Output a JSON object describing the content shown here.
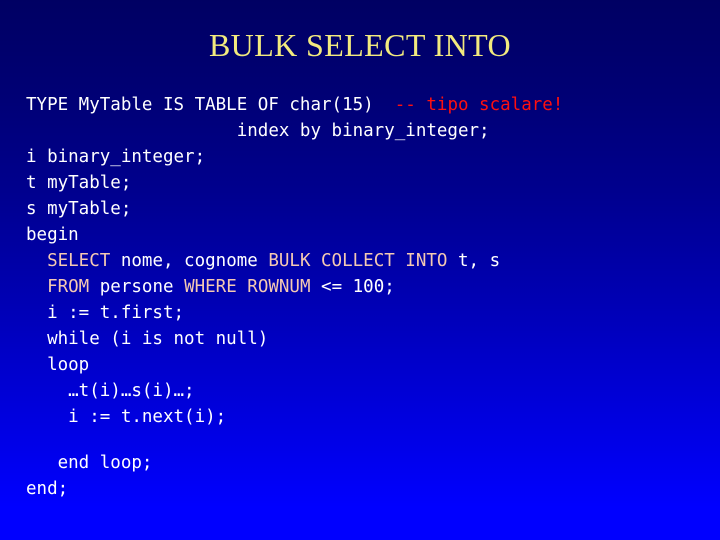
{
  "slide": {
    "title": "BULK SELECT INTO",
    "colors": {
      "background_top": "#000063",
      "background_bottom": "#0000ff",
      "title_text": "#f2ea7e",
      "code_text": "#ffffff",
      "sql_keyword": "#f4c9b2",
      "comment": "#ff0f0f"
    },
    "code": {
      "language": "PL/SQL",
      "lines": [
        {
          "id": "line-1",
          "indent": 0,
          "segments": [
            {
              "text": "TYPE MyTable IS TABLE OF char(15)  ",
              "style": "plain"
            },
            {
              "text": "-- tipo scalare!",
              "style": "comment"
            }
          ]
        },
        {
          "id": "line-2",
          "indent": 0,
          "segments": [
            {
              "text": "                    index by binary_integer;",
              "style": "plain"
            }
          ]
        },
        {
          "id": "line-3",
          "indent": 0,
          "segments": [
            {
              "text": "i binary_integer;",
              "style": "plain"
            }
          ]
        },
        {
          "id": "line-4",
          "indent": 0,
          "segments": [
            {
              "text": "t myTable;",
              "style": "plain"
            }
          ]
        },
        {
          "id": "line-5",
          "indent": 0,
          "segments": [
            {
              "text": "s myTable;",
              "style": "plain"
            }
          ]
        },
        {
          "id": "line-6",
          "indent": 0,
          "segments": [
            {
              "text": "begin",
              "style": "plain"
            }
          ]
        },
        {
          "id": "line-7",
          "indent": 0,
          "segments": [
            {
              "text": "  ",
              "style": "plain"
            },
            {
              "text": "SELECT",
              "style": "keyword"
            },
            {
              "text": " nome, cognome ",
              "style": "plain"
            },
            {
              "text": "BULK COLLECT INTO",
              "style": "keyword"
            },
            {
              "text": " t, s",
              "style": "plain"
            }
          ]
        },
        {
          "id": "line-8",
          "indent": 0,
          "segments": [
            {
              "text": "  ",
              "style": "plain"
            },
            {
              "text": "FROM",
              "style": "keyword"
            },
            {
              "text": " persone ",
              "style": "plain"
            },
            {
              "text": "WHERE ROWNUM",
              "style": "keyword"
            },
            {
              "text": " <= 100;",
              "style": "plain"
            }
          ]
        },
        {
          "id": "line-9",
          "indent": 0,
          "segments": [
            {
              "text": "  i := t.first;",
              "style": "plain"
            }
          ]
        },
        {
          "id": "line-10",
          "indent": 0,
          "segments": [
            {
              "text": "  while (i is not null)",
              "style": "plain"
            }
          ]
        },
        {
          "id": "line-11",
          "indent": 0,
          "segments": [
            {
              "text": "  loop",
              "style": "plain"
            }
          ]
        },
        {
          "id": "line-12",
          "indent": 0,
          "segments": [
            {
              "text": "    …t(i)…s(i)…;",
              "style": "plain"
            }
          ]
        },
        {
          "id": "line-13",
          "indent": 0,
          "segments": [
            {
              "text": "    i := t.next(i);",
              "style": "plain"
            }
          ]
        },
        {
          "id": "line-14",
          "indent": 0,
          "blank": true,
          "segments": [
            {
              "text": " ",
              "style": "plain"
            }
          ]
        },
        {
          "id": "line-15",
          "indent": 0,
          "segments": [
            {
              "text": "   end loop;",
              "style": "plain"
            }
          ]
        },
        {
          "id": "line-16",
          "indent": 0,
          "segments": [
            {
              "text": "end;",
              "style": "plain"
            }
          ]
        }
      ]
    }
  }
}
